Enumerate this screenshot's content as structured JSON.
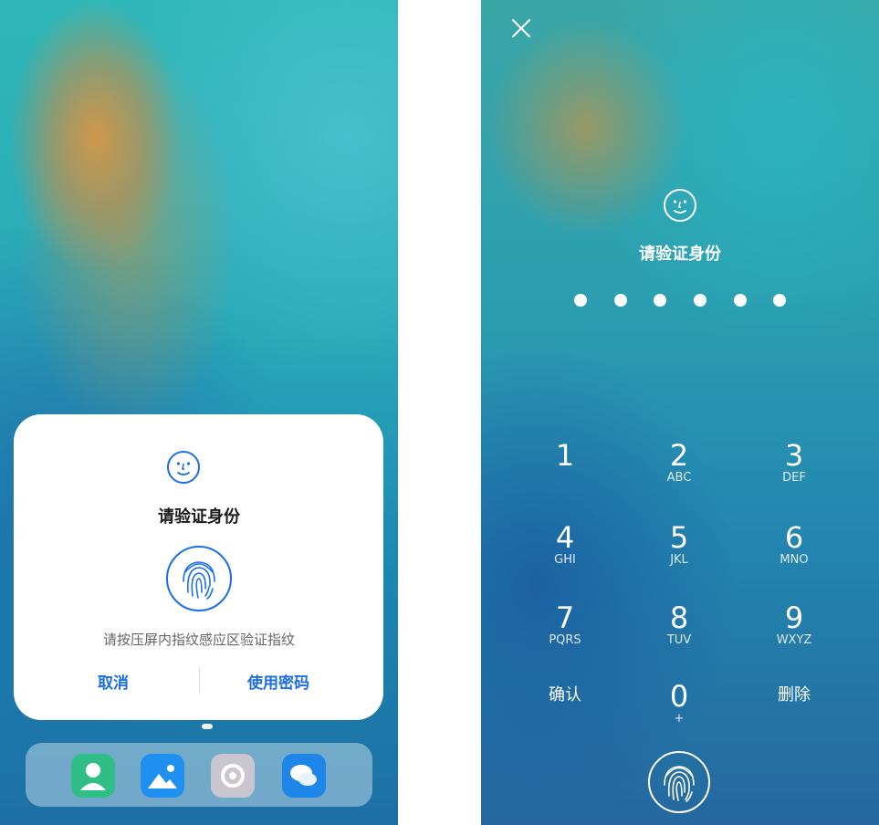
{
  "left": {
    "dialog": {
      "title": "请验证身份",
      "hint": "请按压屏内指纹感应区验证指纹",
      "cancel_label": "取消",
      "use_password_label": "使用密码",
      "accent_color": "#1b6ee8"
    },
    "dock_apps": [
      {
        "icon": "contacts-icon",
        "color": "#2fbf86"
      },
      {
        "icon": "gallery-icon",
        "color": "#1f8ff0"
      },
      {
        "icon": "camera-icon",
        "color": "#c9c6cf"
      },
      {
        "icon": "messages-icon",
        "color": "#1e86e8"
      }
    ]
  },
  "right": {
    "title": "请验证身份",
    "pin_dots": 6,
    "keypad": [
      {
        "num": "1",
        "letters": ""
      },
      {
        "num": "2",
        "letters": "ABC"
      },
      {
        "num": "3",
        "letters": "DEF"
      },
      {
        "num": "4",
        "letters": "GHI"
      },
      {
        "num": "5",
        "letters": "JKL"
      },
      {
        "num": "6",
        "letters": "MNO"
      },
      {
        "num": "7",
        "letters": "PQRS"
      },
      {
        "num": "8",
        "letters": "TUV"
      },
      {
        "num": "9",
        "letters": "WXYZ"
      },
      {
        "num": "0",
        "letters": "+"
      }
    ],
    "confirm_label": "确认",
    "delete_label": "删除"
  }
}
